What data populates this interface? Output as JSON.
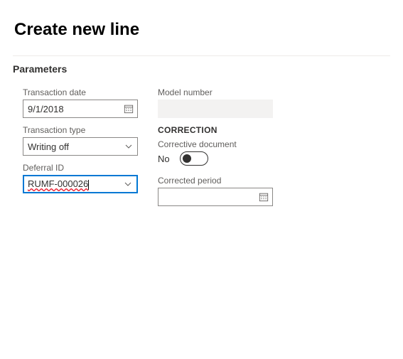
{
  "page": {
    "title": "Create new line"
  },
  "section": {
    "parameters_label": "Parameters"
  },
  "fields": {
    "transaction_date": {
      "label": "Transaction date",
      "value": "9/1/2018"
    },
    "transaction_type": {
      "label": "Transaction type",
      "value": "Writing off"
    },
    "deferral_id": {
      "label": "Deferral ID",
      "value": "RUMF-000026"
    },
    "model_number": {
      "label": "Model number",
      "value": ""
    },
    "corrected_period": {
      "label": "Corrected period",
      "value": ""
    }
  },
  "correction": {
    "heading": "CORRECTION",
    "corrective_document_label": "Corrective document",
    "corrective_document_value": "No"
  }
}
